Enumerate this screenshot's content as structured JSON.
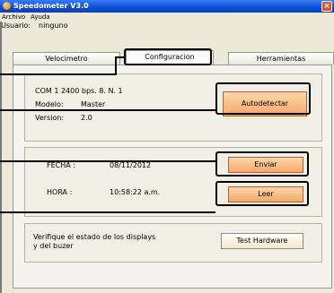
{
  "window": {
    "title": "Speedometer V3.0",
    "close_label": "×"
  },
  "menu": {
    "items": [
      "Archivo",
      "Ayuda"
    ]
  },
  "user": {
    "label": "Usuario:",
    "value": "ninguno"
  },
  "tabs": [
    {
      "label": "Velocimetro",
      "active": false
    },
    {
      "label": "Configuracion",
      "active": true
    },
    {
      "label": "Herramientas",
      "active": false
    }
  ],
  "connection": {
    "port_line": "COM 1   2400 bps. 8. N. 1",
    "model_label": "Modelo:",
    "model_value": "Master",
    "version_label": "Version:",
    "version_value": "2.0",
    "autodetect_button": "Autodetectar"
  },
  "datetime": {
    "date_label": "FECHA :",
    "date_value": "08/11/2012",
    "time_label": "HORA :",
    "time_value": "10:58:22 a.m.",
    "send_button": "Enviar",
    "read_button": "Leer"
  },
  "hardware": {
    "description_line1": "Verifique el estado de los displays",
    "description_line2": "y del buzer",
    "test_button": "Test Hardware"
  },
  "colors": {
    "titlebar": "#0b4ed6",
    "button_accent": "#f5a86b",
    "background": "#ece9d8"
  }
}
